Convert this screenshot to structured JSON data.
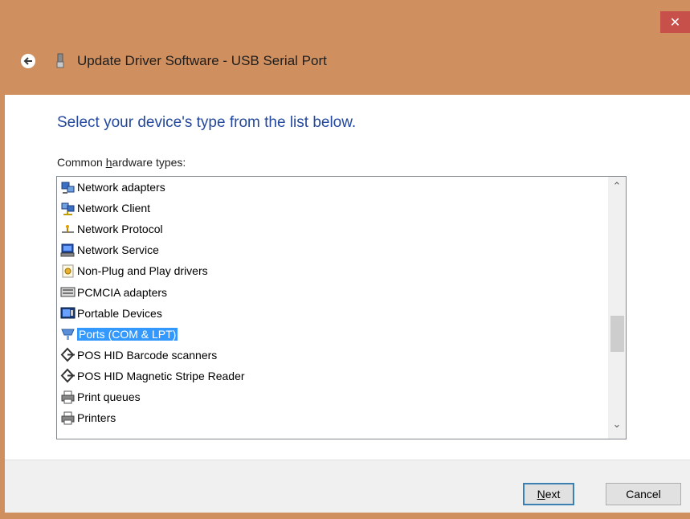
{
  "window": {
    "title": "Update Driver Software - USB Serial Port",
    "close_glyph": "✕",
    "frame_color": "#cf8f5e"
  },
  "main": {
    "heading": "Select your device's type from the list below.",
    "list_label_prefix": "Common ",
    "list_label_accel": "h",
    "list_label_suffix": "ardware types:",
    "hardware_types": [
      {
        "label": "Network adapters",
        "icon": "network-adapter-icon"
      },
      {
        "label": "Network Client",
        "icon": "network-client-icon"
      },
      {
        "label": "Network Protocol",
        "icon": "network-protocol-icon"
      },
      {
        "label": "Network Service",
        "icon": "network-service-icon"
      },
      {
        "label": "Non-Plug and Play drivers",
        "icon": "non-pnp-driver-icon"
      },
      {
        "label": "PCMCIA adapters",
        "icon": "pcmcia-icon"
      },
      {
        "label": "Portable Devices",
        "icon": "portable-device-icon"
      },
      {
        "label": "Ports (COM & LPT)",
        "icon": "port-icon",
        "selected": true
      },
      {
        "label": "POS HID Barcode scanners",
        "icon": "pos-hid-icon"
      },
      {
        "label": "POS HID Magnetic Stripe Reader",
        "icon": "pos-hid-icon"
      },
      {
        "label": "Print queues",
        "icon": "printer-icon"
      },
      {
        "label": "Printers",
        "icon": "printer-icon"
      }
    ]
  },
  "footer": {
    "next_accel": "N",
    "next_rest": "ext",
    "cancel_label": "Cancel"
  },
  "colors": {
    "accent": "#23489e",
    "selection": "#3399ff"
  }
}
